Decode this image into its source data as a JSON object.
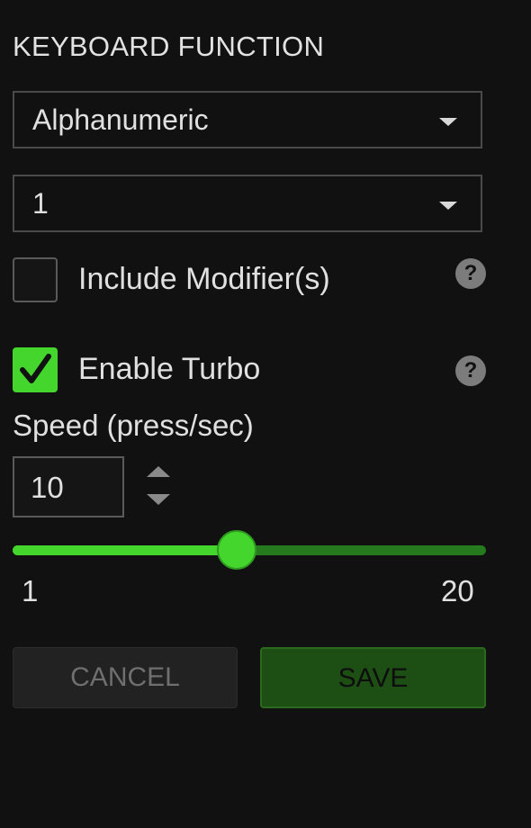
{
  "keyboard_function": {
    "title": "KEYBOARD FUNCTION",
    "type_select": {
      "value": "Alphanumeric"
    },
    "key_select": {
      "value": "1"
    }
  },
  "include_modifiers": {
    "label": "Include Modifier(s)",
    "checked": false,
    "help": "?"
  },
  "enable_turbo": {
    "label": "Enable Turbo",
    "checked": true,
    "help": "?"
  },
  "speed": {
    "label": "Speed (press/sec)",
    "value": "10",
    "min_label": "1",
    "max_label": "20"
  },
  "buttons": {
    "cancel": "CANCEL",
    "save": "SAVE"
  },
  "colors": {
    "accent": "#44d62c",
    "accent_dark": "#247a1d",
    "background": "#111111"
  }
}
